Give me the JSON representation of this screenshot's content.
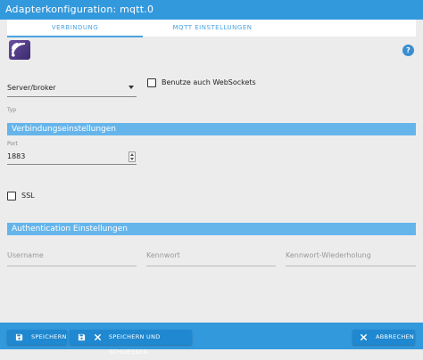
{
  "window": {
    "title": "Adapterkonfiguration: mqtt.0"
  },
  "tabs": [
    {
      "label": "VERBINDUNG"
    },
    {
      "label": "MQTT EINSTELLUNGEN"
    }
  ],
  "connection": {
    "type_value": "Server/broker",
    "type_helper": "Typ",
    "websockets_label": "Benutze auch WebSockets"
  },
  "sections": {
    "connection_settings": "Verbindungseinstellungen",
    "auth_settings": "Authentication Einstellungen"
  },
  "port": {
    "label": "Port",
    "value": "1883"
  },
  "ssl": {
    "label": "SSL"
  },
  "auth": {
    "username_placeholder": "Username",
    "password_placeholder": "Kennwort",
    "password_repeat_placeholder": "Kennwort-Wiederholung"
  },
  "footer": {
    "save": "SPEICHERN",
    "save_close": "SPEICHERN UND SCHLIESSEN",
    "cancel": "ABBRECHEN"
  },
  "help": {
    "icon_text": "?"
  },
  "colors": {
    "accent": "#3399dd",
    "section": "#66b5ea",
    "background": "#ececec"
  }
}
